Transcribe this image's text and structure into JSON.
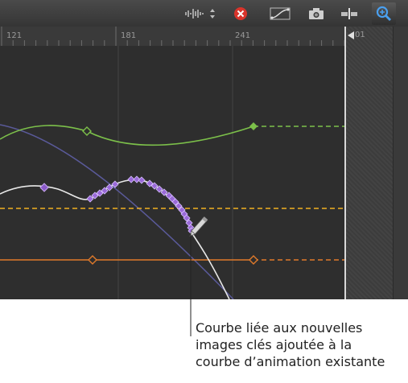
{
  "ruler": {
    "ticks": [
      "121",
      "181",
      "241"
    ],
    "end_label": "01"
  },
  "toolbar": {
    "icons": [
      "audio-waveform-icon",
      "updown-arrows-icon",
      "close-circle-icon",
      "curve-fit-icon",
      "camera-icon",
      "snap-icon",
      "zoom-icon"
    ]
  },
  "colors": {
    "green_curve": "#7cc04a",
    "white_curve": "#e8e8e8",
    "orange_line": "#e07a2a",
    "yellow_dashed": "#f0b020",
    "purple_keyframe": "#9a6ad8",
    "blue_curve": "#5a5a9a"
  },
  "callout": {
    "lines": [
      "Courbe liée aux nouvelles",
      "images clés ajoutée à la",
      "courbe d’animation existante"
    ]
  }
}
